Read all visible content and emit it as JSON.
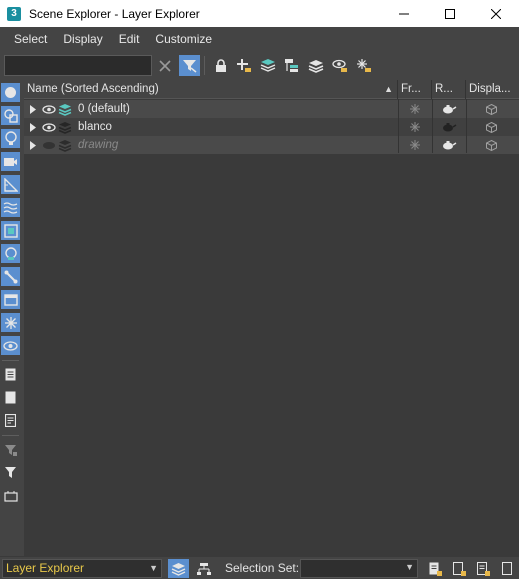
{
  "window": {
    "app_icon_label": "3",
    "title": "Scene Explorer - Layer Explorer",
    "minimize": "minimize-icon",
    "maximize": "maximize-icon",
    "close": "close-icon"
  },
  "menu": [
    "Select",
    "Display",
    "Edit",
    "Customize"
  ],
  "toolbar": {
    "search_value": "",
    "clear_icon": "clear-x-icon",
    "icons": [
      "filter-toggle-icon",
      "lock-icon",
      "add-to-layer-icon",
      "layers-icon",
      "hierarchy-icon",
      "layer-stack-icon",
      "eye-layer-icon",
      "freeze-layer-icon"
    ]
  },
  "leftbar_icons": [
    "geometry-icon",
    "shapes-icon",
    "lights-icon",
    "cameras-icon",
    "helpers-icon",
    "space-warps-icon",
    "groups-icon",
    "xrefs-icon",
    "bones-icon",
    "containers-icon",
    "frozen-icon",
    "hidden-icon",
    "display-all-icon",
    "display-none-icon",
    "invert-display-icon",
    "filter-options-icon",
    "filter-icon",
    "selection-toggle-icon"
  ],
  "table": {
    "columns": [
      "Name (Sorted Ascending)",
      "Fr...",
      "R...",
      "Displa..."
    ],
    "rows": [
      {
        "name": "0 (default)",
        "state": "active"
      },
      {
        "name": "blanco",
        "state": "normal"
      },
      {
        "name": "drawing",
        "state": "hidden"
      }
    ]
  },
  "bottom": {
    "explorer": "Layer Explorer",
    "selection_set_label": "Selection Set:",
    "selection_set_value": ""
  },
  "colors": {
    "accent": "#5b8fcf",
    "background": "#444444",
    "list_bg": "#3a3a3a",
    "explorer_text": "#e8c84a"
  }
}
